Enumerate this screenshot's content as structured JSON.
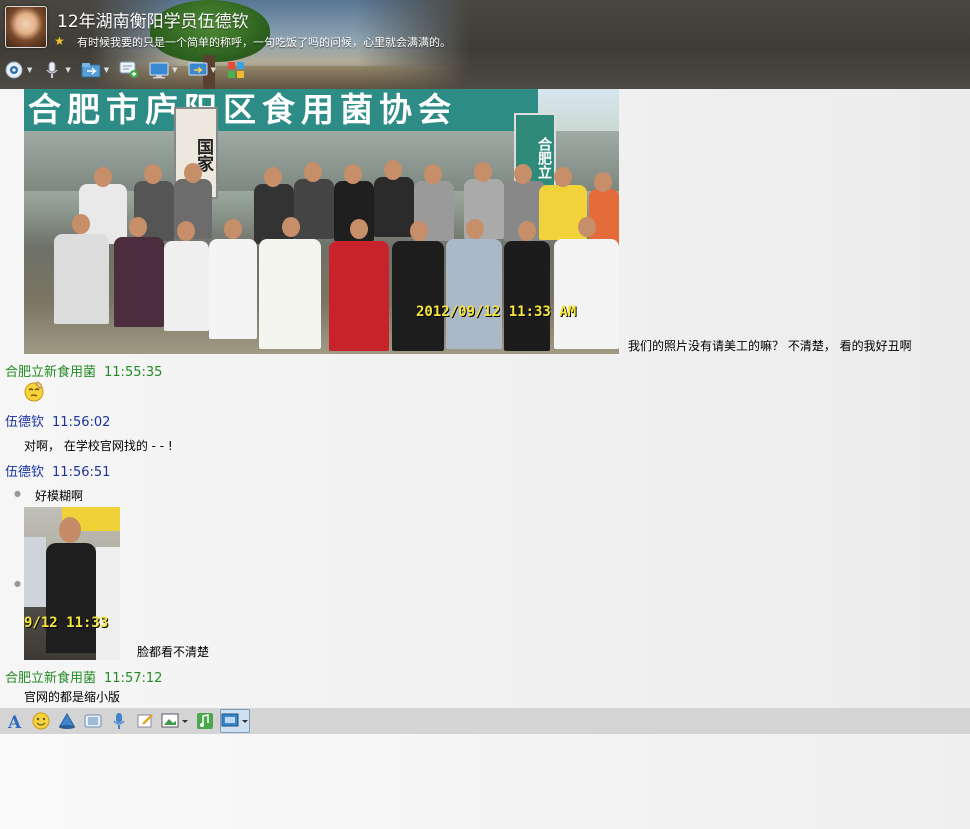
{
  "header": {
    "title": "12年湖南衡阳学员伍德钦",
    "signature": "有时候我要的只是一个简单的称呼，一句吃饭了吗的问候，心里就会满满的。",
    "toolbar": [
      {
        "icon": "camera-icon",
        "has_menu": true
      },
      {
        "icon": "microphone-icon",
        "has_menu": true
      },
      {
        "icon": "folder-transfer-icon",
        "has_menu": true
      },
      {
        "icon": "create-discussion-icon",
        "has_menu": false
      },
      {
        "icon": "remote-desktop-icon",
        "has_menu": true
      },
      {
        "icon": "share-screen-icon",
        "has_menu": true
      },
      {
        "icon": "apps-icon",
        "has_menu": false
      }
    ]
  },
  "photo_main": {
    "banner": "合肥市庐阳区食用菌协会",
    "sign_left": "国家",
    "sign_right": "合肥立",
    "date_stamp": "2012/09/12 11:33 AM"
  },
  "messages": {
    "m1_text": "我们的照片没有请美工的嘛？  不清楚，  看的我好丑啊",
    "m2_sender": "合肥立新食用菌",
    "m2_time": "11:55:35",
    "m3_sender": "伍德钦",
    "m3_time": "11:56:02",
    "m3_text": "对啊，    在学校官网找的     - - !",
    "m4_sender": "伍德钦",
    "m4_time": "11:56:51",
    "m4_text1": "好模糊啊",
    "m4_small_stamp": "9/12 11:33",
    "m4_text2": "脸都看不清楚",
    "m5_sender": "合肥立新食用菌",
    "m5_time": "11:57:12",
    "m5_text": "官网的都是缩小版"
  },
  "colors": {
    "sender_peer": "#228b22",
    "sender_self": "#1a33a0",
    "toolbar_bg": "#d4d4d4"
  },
  "input_toolbar": [
    "font-icon",
    "emoji-icon",
    "shake-window-icon",
    "magic-expression-icon",
    "voice-message-icon",
    "doodle-icon",
    "send-image-icon",
    "music-icon",
    "screenshot-icon"
  ]
}
